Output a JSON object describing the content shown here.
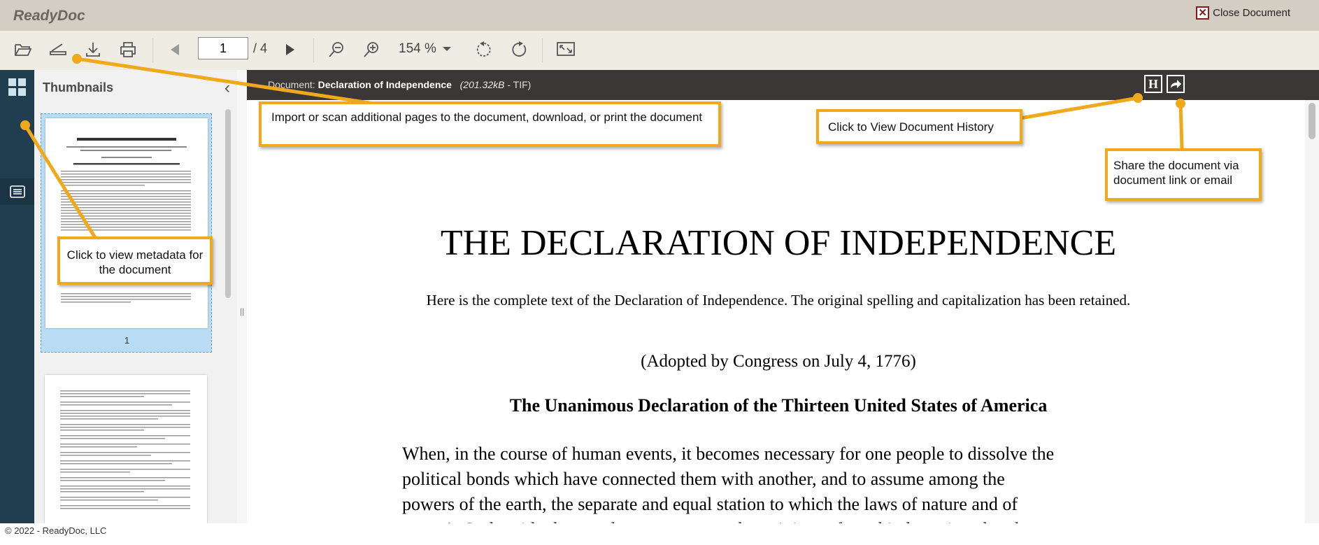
{
  "app": {
    "title": "ReadyDoc",
    "close_label": "Close Document"
  },
  "toolbar": {
    "icons": [
      "folder-open-icon",
      "scan-icon",
      "download-icon",
      "print-icon",
      "prev-page-icon",
      "next-page-icon",
      "zoom-out-icon",
      "zoom-in-icon",
      "rotate-left-icon",
      "rotate-right-icon",
      "fit-page-icon"
    ],
    "page_value": "1",
    "page_total": "/ 4",
    "zoom_value": "154 %"
  },
  "thumbnails": {
    "title": "Thumbnails",
    "page_1_label": "1"
  },
  "document": {
    "label": "Document:",
    "name": "Declaration of Independence",
    "size": "(201.32kB",
    "type": " - TIF)",
    "history_button": "H",
    "title": "THE DECLARATION OF INDEPENDENCE",
    "intro": "Here is the complete text of the Declaration of Independence. The original spelling and capitalization has been retained.",
    "adopted": "(Adopted by Congress on July 4, 1776)",
    "subtitle": "The Unanimous Declaration of the Thirteen United States of America",
    "paragraph": "When, in the course of human events, it becomes necessary for one people to dissolve the\npolitical bonds which have connected them with another, and to assume among the\npowers of the earth, the separate and equal station to which the laws of nature and of\nnature's God entitle them, a decent respect to the opinions of mankind requires that they"
  },
  "callouts": {
    "import": "Import or scan additional pages to the document, download, or print the document",
    "history": "Click to View Document History",
    "share": "Share the document via document link or email",
    "metadata": "Click to view metadata for the document"
  },
  "footer": {
    "copyright": "© 2022 - ReadyDoc, LLC"
  },
  "colors": {
    "callout_border": "#f0a91a",
    "rail": "#203e4f",
    "doc_header": "#3b3737",
    "titlebar": "#d3cdc3"
  }
}
